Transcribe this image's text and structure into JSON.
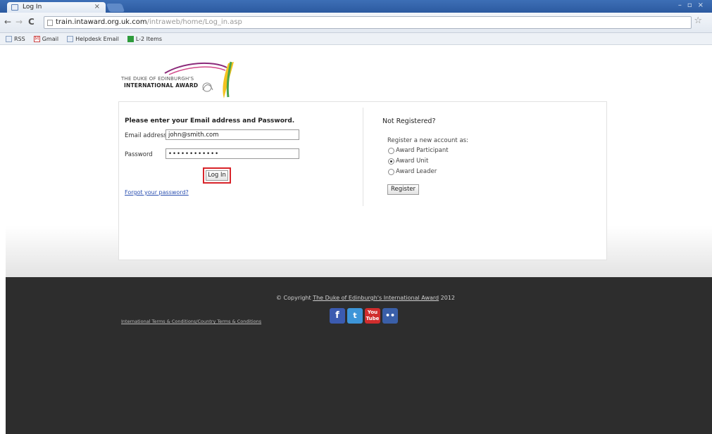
{
  "browser": {
    "tab_title": "Log In",
    "tab_close": "×",
    "window_controls": [
      "–",
      "▫",
      "×"
    ],
    "nav": {
      "back": "←",
      "forward": "→",
      "reload": "C"
    },
    "url_domain": "train.intaward.org.uk.com",
    "url_path": "/intraweb/home/Log_in.asp",
    "bookmarks": [
      "RSS",
      "Gmail",
      "Helpdesk Email",
      "L-2 Items"
    ]
  },
  "logo": {
    "line1": "THE DUKE OF EDINBURGH'S",
    "line2": "INTERNATIONAL AWARD"
  },
  "login": {
    "heading": "Please enter your Email address and Password.",
    "email_label": "Email address",
    "email_value": "john@smith.com",
    "password_label": "Password",
    "password_value": "••••••••••••",
    "button_label": "Log In",
    "forgot_link": "Forgot your password?"
  },
  "register": {
    "heading": "Not Registered?",
    "subheading": "Register a new account as:",
    "options": [
      {
        "label": "Award Participant",
        "checked": false
      },
      {
        "label": "Award Unit",
        "checked": true
      },
      {
        "label": "Award Leader",
        "checked": false
      }
    ],
    "button_label": "Register"
  },
  "footer": {
    "copyright_prefix": "© Copyright",
    "copyright_link": "The Duke of Edinburgh's International Award",
    "copyright_year": "2012",
    "terms_link": "International Terms & Conditions/Country Terms & Conditions",
    "social": {
      "facebook": "f",
      "twitter": "t",
      "youtube_top": "You",
      "youtube_bottom": "Tube",
      "flickr": "••"
    }
  },
  "colors": {
    "titlebar": "#2c5aa0",
    "login_highlight": "#d8242a",
    "footer_bg": "#2d2d2d",
    "link": "#2a4fb0"
  }
}
